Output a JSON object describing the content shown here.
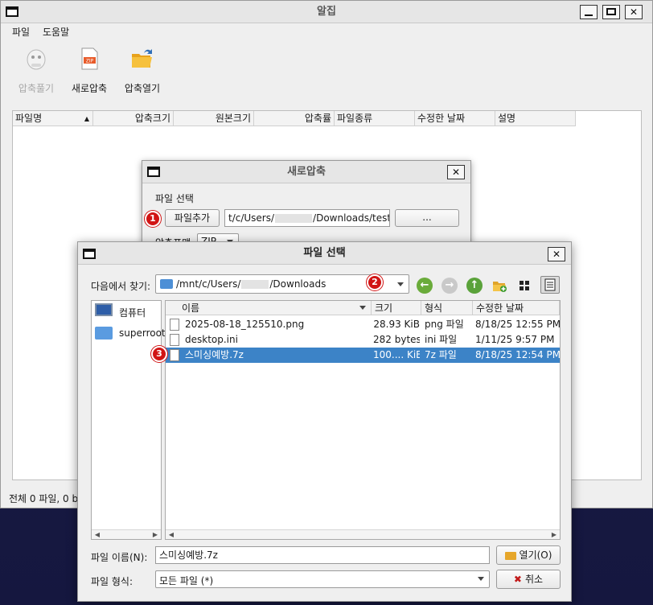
{
  "main": {
    "title": "알집",
    "menu": [
      "파일",
      "도움말"
    ],
    "toolbar": {
      "extract": "압축풀기",
      "new_archive": "새로압축",
      "open_archive": "압축열기"
    },
    "columns": [
      "파일명",
      "압축크기",
      "원본크기",
      "압축률",
      "파일종류",
      "수정한 날짜",
      "설명"
    ],
    "status": "전체 0 파일, 0 b"
  },
  "new_archive": {
    "title": "새로압축",
    "section_label": "파일 선택",
    "add_button": "파일추가",
    "path_prefix": "t/c/Users/",
    "path_suffix": "/Downloads/test.zip",
    "browse_button": "...",
    "format_label": "압축포맷",
    "format_value": "ZIP"
  },
  "file_dialog": {
    "title": "파일 선택",
    "look_in_label": "다음에서 찾기:",
    "path_prefix": "/mnt/c/Users/",
    "path_suffix": "/Downloads",
    "places": [
      {
        "label": "컴퓨터",
        "icon": "computer-icon"
      },
      {
        "label": "superroot",
        "icon": "folder-icon"
      }
    ],
    "columns": [
      "이름",
      "크기",
      "형식",
      "수정한 날짜"
    ],
    "files": [
      {
        "name": "2025-08-18_125510.png",
        "size": "28.93 KiB",
        "type": "png 파일",
        "date": "8/18/25 12:55 PM",
        "selected": false
      },
      {
        "name": "desktop.ini",
        "size": "282 bytes",
        "type": "ini 파일",
        "date": "1/11/25 9:57 PM",
        "selected": false
      },
      {
        "name": "스미싱예방.7z",
        "size": "100.... KiB",
        "type": "7z 파일",
        "date": "8/18/25 12:54 PM",
        "selected": true
      }
    ],
    "filename_label": "파일 이름(N):",
    "filename_value": "스미싱예방.7z",
    "filetype_label": "파일 형식:",
    "filetype_value": "모든 파일 (*)",
    "open_button": "열기(O)",
    "cancel_button": "취소"
  },
  "badges": [
    "1",
    "2",
    "3"
  ],
  "colors": {
    "selection": "#3c83c7",
    "badge": "#d11414",
    "desktop": "#1b1d4a"
  }
}
